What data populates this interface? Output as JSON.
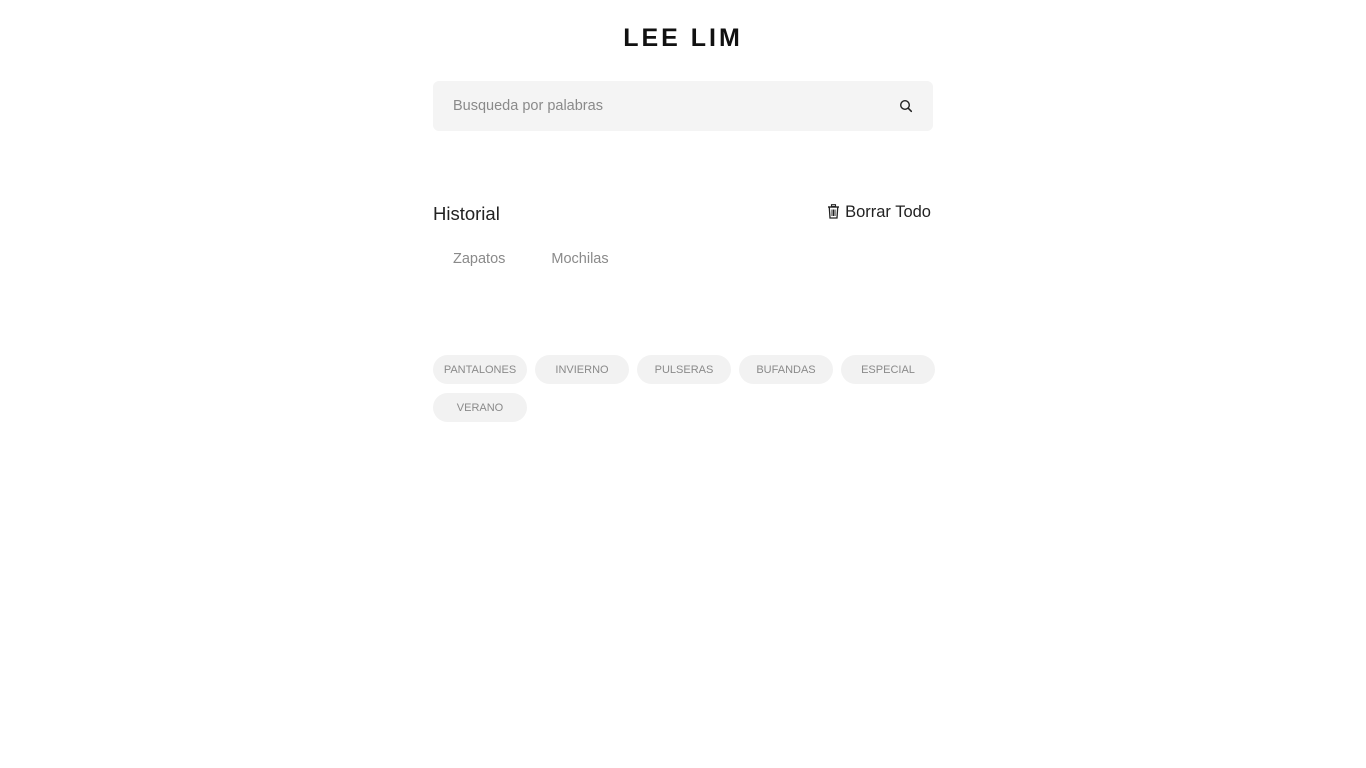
{
  "header": {
    "brand": "LEE LIM"
  },
  "search": {
    "placeholder": "Busqueda por palabras",
    "value": "",
    "icon": "search-icon"
  },
  "history": {
    "title": "Historial",
    "clear_label": "Borrar Todo",
    "clear_icon": "trash-icon",
    "items": [
      {
        "label": "Zapatos"
      },
      {
        "label": "Mochilas"
      }
    ]
  },
  "tags": [
    {
      "label": "PANTALONES"
    },
    {
      "label": "INVIERNO"
    },
    {
      "label": "PULSERAS"
    },
    {
      "label": "BUFANDAS"
    },
    {
      "label": "ESPECIAL"
    },
    {
      "label": "VERANO"
    }
  ],
  "colors": {
    "background": "#ffffff",
    "search_background": "#f4f4f4",
    "tag_background": "#f2f2f2",
    "muted_text": "#8a8a8a",
    "primary_text": "#222222"
  }
}
